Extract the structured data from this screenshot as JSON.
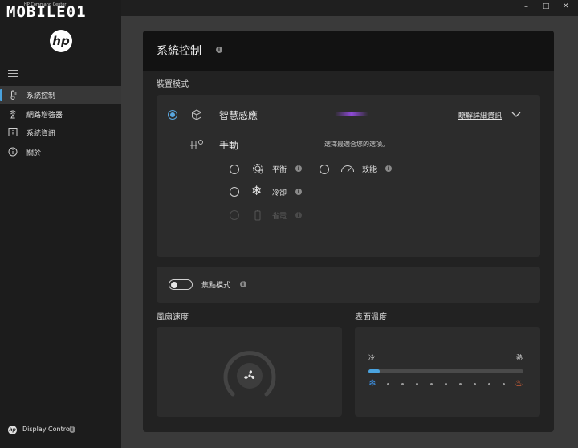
{
  "watermark": "MOBILE01",
  "app": {
    "title": "HP Command Center",
    "logo_text": "hp"
  },
  "window_controls": {
    "minimize": "–",
    "maximize": "□",
    "close": "✕"
  },
  "sidebar": {
    "items": [
      {
        "label": "系統控制",
        "icon": "thermometer-icon",
        "active": true
      },
      {
        "label": "網路增強器",
        "icon": "network-booster-icon",
        "active": false
      },
      {
        "label": "系統資訊",
        "icon": "system-info-icon",
        "active": false
      },
      {
        "label": "關於",
        "icon": "about-info-icon",
        "active": false
      }
    ],
    "footer_label": "Display Control"
  },
  "page": {
    "title": "系統控制",
    "device_mode": {
      "heading": "裝置模式",
      "smart_sense": {
        "label": "智慧感應",
        "selected": true,
        "learn_more": "瞭解詳細資訊"
      },
      "manual": {
        "label": "手動",
        "hint": "選擇最適合您的選項。",
        "options": [
          {
            "label": "平衡",
            "icon": "gear-balance-icon",
            "enabled": true
          },
          {
            "label": "效能",
            "icon": "speedometer-icon",
            "enabled": true
          },
          {
            "label": "冷卻",
            "icon": "snowflake-icon",
            "enabled": true
          },
          {
            "label": "省電",
            "icon": "battery-icon",
            "enabled": false
          }
        ]
      }
    },
    "focus_mode": {
      "label": "焦點模式",
      "enabled": false
    },
    "fan_speed": {
      "heading": "風扇速度"
    },
    "surface_temp": {
      "heading": "表面溫度",
      "cold_label": "冷",
      "hot_label": "熱",
      "level": 0.07
    }
  },
  "colors": {
    "accent": "#4aa3df",
    "hot": "#e0643a",
    "cold": "#3d8fe0"
  }
}
